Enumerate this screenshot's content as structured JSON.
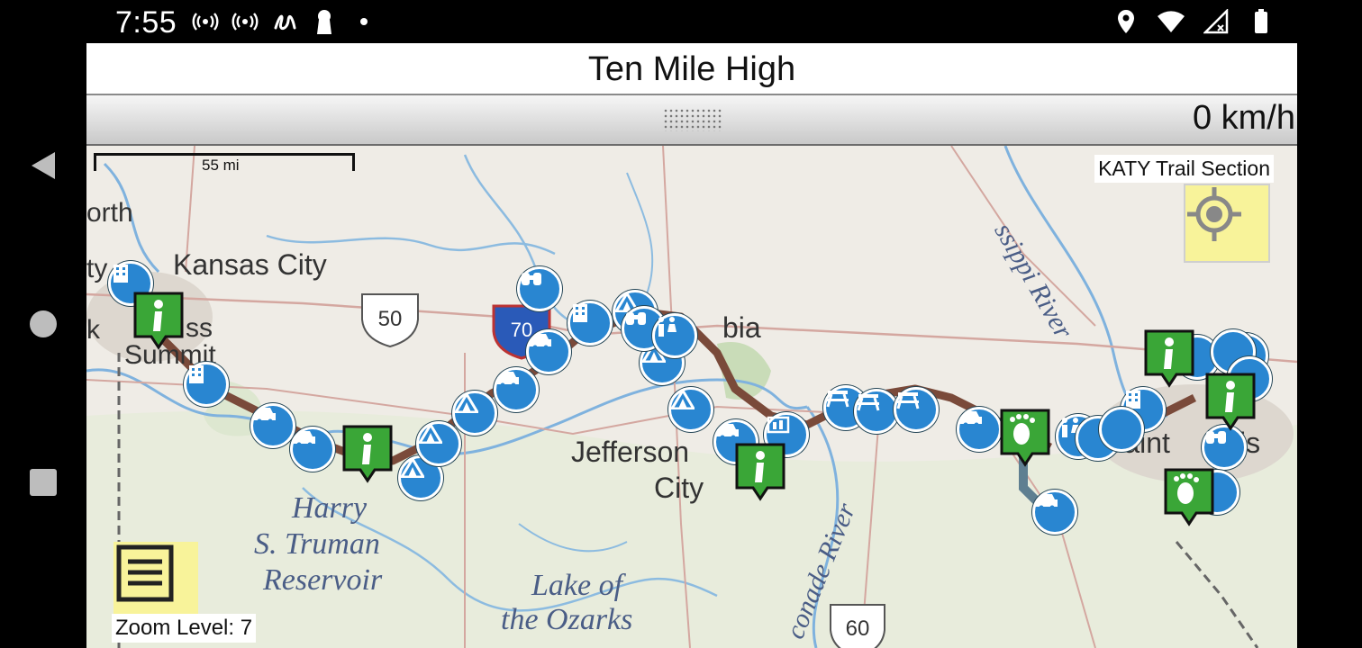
{
  "status_bar": {
    "time": "7:55"
  },
  "app": {
    "title": "Ten Mile High",
    "speed": "0 km/h"
  },
  "map": {
    "scale_label": "55 mi",
    "section_label": "KATY Trail Section",
    "zoom_label": "Zoom Level: 7",
    "place_labels": {
      "kansas_city": "Kansas City",
      "north": "orth",
      "ty": "ty",
      "lees": "ss",
      "summit": "Summit",
      "k": "k",
      "columbia": "bia",
      "jefferson": "Jefferson",
      "city": "City",
      "harry": "Harry",
      "truman": "S. Truman",
      "reservoir": "Reservoir",
      "lake": "Lake of",
      "ozarks": "the Ozarks",
      "mississippi": "ssippi River",
      "gasconade": "conade River",
      "saint_louis": "Saint",
      "louis": "is"
    },
    "shields": {
      "us50": "50",
      "us60": "60",
      "i70": "70"
    }
  },
  "colors": {
    "poi_blue": "#2986d1",
    "info_green": "#3aa637",
    "route_brown": "#7a4a3a",
    "route_slate": "#5f7f91",
    "button_yellow": "#f8f39a"
  },
  "icons": {
    "status": [
      "hotspot-icon",
      "hotspot-icon",
      "signature-icon",
      "keyhole-icon",
      "dot-icon",
      "location-icon",
      "wifi-icon",
      "signal-icon",
      "battery-icon"
    ],
    "nav": [
      "back-icon",
      "home-icon",
      "recents-icon"
    ]
  }
}
